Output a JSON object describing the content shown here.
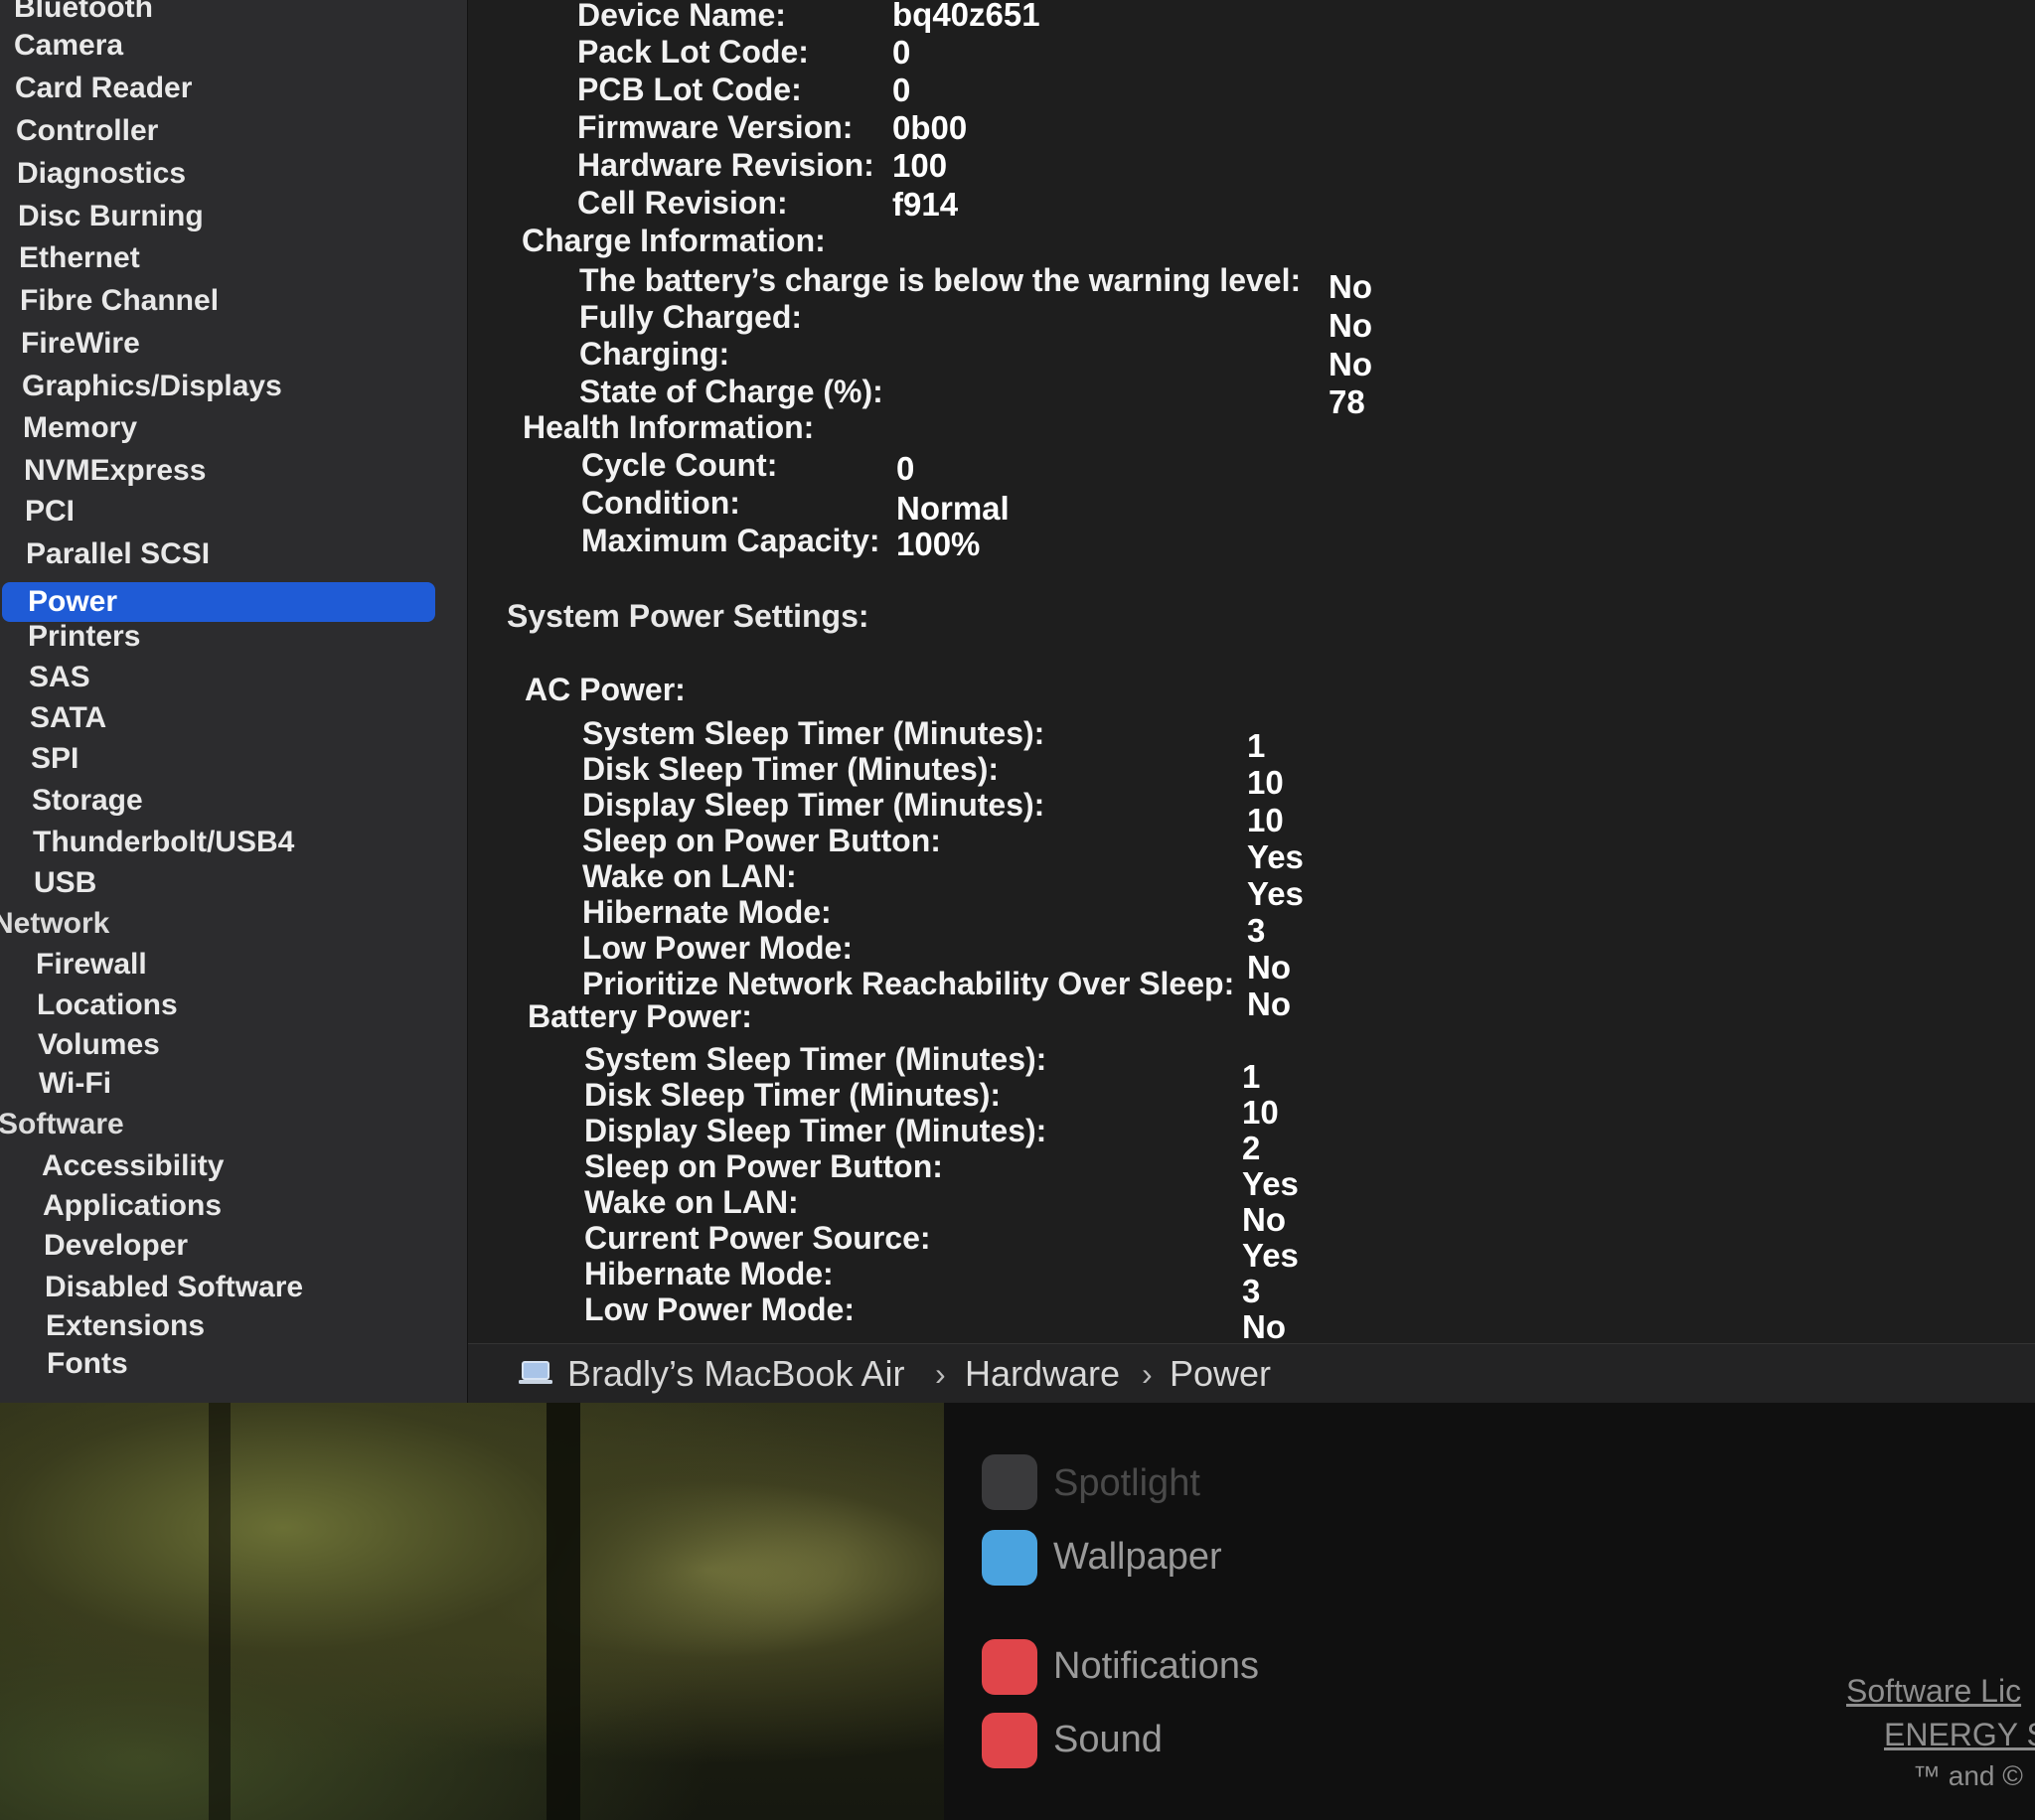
{
  "sidebar": {
    "items": [
      {
        "label": "Bluetooth"
      },
      {
        "label": "Camera"
      },
      {
        "label": "Card Reader"
      },
      {
        "label": "Controller"
      },
      {
        "label": "Diagnostics"
      },
      {
        "label": "Disc Burning"
      },
      {
        "label": "Ethernet"
      },
      {
        "label": "Fibre Channel"
      },
      {
        "label": "FireWire"
      },
      {
        "label": "Graphics/Displays"
      },
      {
        "label": "Memory"
      },
      {
        "label": "NVMExpress"
      },
      {
        "label": "PCI"
      },
      {
        "label": "Parallel SCSI"
      },
      {
        "label": "Power"
      },
      {
        "label": "Printers"
      },
      {
        "label": "SAS"
      },
      {
        "label": "SATA"
      },
      {
        "label": "SPI"
      },
      {
        "label": "Storage"
      },
      {
        "label": "Thunderbolt/USB4"
      },
      {
        "label": "USB"
      },
      {
        "label": "Network"
      },
      {
        "label": "Firewall"
      },
      {
        "label": "Locations"
      },
      {
        "label": "Volumes"
      },
      {
        "label": "Wi-Fi"
      },
      {
        "label": "Software"
      },
      {
        "label": "Accessibility"
      },
      {
        "label": "Applications"
      },
      {
        "label": "Developer"
      },
      {
        "label": "Disabled Software"
      },
      {
        "label": "Extensions"
      },
      {
        "label": "Fonts"
      }
    ],
    "selected": "Power"
  },
  "battery_info": {
    "device_name": {
      "label": "Device Name:",
      "value": "bq40z651"
    },
    "pack_lot_code": {
      "label": "Pack Lot Code:",
      "value": "0"
    },
    "pcb_lot_code": {
      "label": "PCB Lot Code:",
      "value": "0"
    },
    "firmware_version": {
      "label": "Firmware Version:",
      "value": "0b00"
    },
    "hardware_revision": {
      "label": "Hardware Revision:",
      "value": "100"
    },
    "cell_revision": {
      "label": "Cell Revision:",
      "value": "f914"
    }
  },
  "charge_information": {
    "heading": "Charge Information:",
    "below_warning": {
      "label": "The battery’s charge is below the warning level:",
      "value": "No"
    },
    "fully_charged": {
      "label": "Fully Charged:",
      "value": "No"
    },
    "charging": {
      "label": "Charging:",
      "value": "No"
    },
    "state_of_charge": {
      "label": "State of Charge (%):",
      "value": "78"
    }
  },
  "health_information": {
    "heading": "Health Information:",
    "cycle_count": {
      "label": "Cycle Count:",
      "value": "0"
    },
    "condition": {
      "label": "Condition:",
      "value": "Normal"
    },
    "maximum_capacity": {
      "label": "Maximum Capacity:",
      "value": "100%"
    }
  },
  "system_power_settings": {
    "heading": "System Power Settings:",
    "ac_power": {
      "heading": "AC Power:",
      "rows": [
        {
          "label": "System Sleep Timer (Minutes):",
          "value": "1"
        },
        {
          "label": "Disk Sleep Timer (Minutes):",
          "value": "10"
        },
        {
          "label": "Display Sleep Timer (Minutes):",
          "value": "10"
        },
        {
          "label": "Sleep on Power Button:",
          "value": "Yes"
        },
        {
          "label": "Wake on LAN:",
          "value": "Yes"
        },
        {
          "label": "Hibernate Mode:",
          "value": "3"
        },
        {
          "label": "Low Power Mode:",
          "value": "No"
        },
        {
          "label": "Prioritize Network Reachability Over Sleep:",
          "value": "No"
        }
      ]
    },
    "battery_power": {
      "heading": "Battery Power:",
      "rows": [
        {
          "label": "System Sleep Timer (Minutes):",
          "value": "1"
        },
        {
          "label": "Disk Sleep Timer (Minutes):",
          "value": "10"
        },
        {
          "label": "Display Sleep Timer (Minutes):",
          "value": "2"
        },
        {
          "label": "Sleep on Power Button:",
          "value": "Yes"
        },
        {
          "label": "Wake on LAN:",
          "value": "No"
        },
        {
          "label": "Current Power Source:",
          "value": "Yes"
        },
        {
          "label": "Hibernate Mode:",
          "value": "3"
        },
        {
          "label": "Low Power Mode:",
          "value": "No"
        }
      ]
    }
  },
  "breadcrumb": {
    "icon": "laptop-icon",
    "items": [
      "Bradly’s MacBook Air",
      "Hardware",
      "Power"
    ],
    "separator": "›"
  },
  "settings_window": {
    "items": [
      {
        "label": "Spotlight",
        "icon": "magnifier-icon",
        "color": "#3a3a3c"
      },
      {
        "label": "Wallpaper",
        "icon": "snowflake-icon",
        "color": "#4aa3df"
      },
      {
        "label": "Notifications",
        "icon": "bell-icon",
        "color": "#e0454a"
      },
      {
        "label": "Sound",
        "icon": "speaker-icon",
        "color": "#e0454a"
      }
    ],
    "footer_links": [
      "Software Lic",
      "ENERGY S"
    ],
    "footer_note": "™ and ©"
  }
}
